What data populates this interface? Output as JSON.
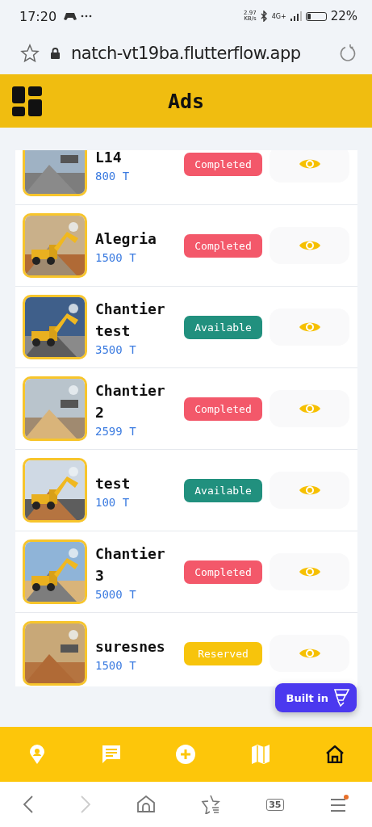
{
  "status_bar": {
    "time": "17:20",
    "speed": "2.97\nKB/s",
    "network": "4G+",
    "battery": "22%"
  },
  "browser": {
    "url": "natch-vt19ba.flutterflow.app",
    "tab_count": "35"
  },
  "app_bar": {
    "title": "Ads"
  },
  "ads": [
    {
      "name": "L14",
      "quantity": "800 T",
      "status": "Completed",
      "color": "#f3586a"
    },
    {
      "name": "Alegria",
      "quantity": "1500 T",
      "status": "Completed",
      "color": "#f3586a"
    },
    {
      "name": "Chantier test",
      "quantity": "3500 T",
      "status": "Available",
      "color": "#21907e"
    },
    {
      "name": "Chantier 2",
      "quantity": "2599 T",
      "status": "Completed",
      "color": "#f3586a"
    },
    {
      "name": "test",
      "quantity": "100 T",
      "status": "Available",
      "color": "#21907e"
    },
    {
      "name": "Chantier 3",
      "quantity": "5000 T",
      "status": "Completed",
      "color": "#f3586a"
    },
    {
      "name": "suresnes",
      "quantity": "1500 T",
      "status": "Reserved",
      "color": "#f7c40c"
    }
  ],
  "built_badge": {
    "label": "Built in"
  },
  "nav": [
    {
      "kind": "pin",
      "selected": false
    },
    {
      "kind": "chat",
      "selected": false
    },
    {
      "kind": "add",
      "selected": false
    },
    {
      "kind": "map",
      "selected": false
    },
    {
      "kind": "home",
      "selected": true
    }
  ]
}
